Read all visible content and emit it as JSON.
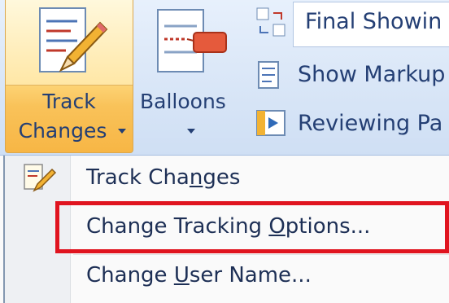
{
  "ribbon": {
    "track_changes": {
      "line1": "Track",
      "line2": "Changes",
      "icon": "track-changes-pencil-icon"
    },
    "balloons": {
      "label": "Balloons",
      "icon": "balloons-icon"
    },
    "final_showing": {
      "label": "Final Showin",
      "icon": "display-for-review-icon"
    },
    "show_markup": {
      "label": "Show Markup",
      "icon": "show-markup-icon"
    },
    "reviewing_pane": {
      "label": "Reviewing Pa",
      "icon": "reviewing-pane-icon"
    }
  },
  "menu": {
    "items": [
      {
        "pre": "Track Cha",
        "key": "n",
        "post": "ges",
        "icon": "track-changes-icon"
      },
      {
        "pre": "Change Tracking ",
        "key": "O",
        "post": "ptions..."
      },
      {
        "pre": "Change ",
        "key": "U",
        "post": "ser Name..."
      }
    ]
  },
  "colors": {
    "highlight": "#e0141f",
    "accent_text": "#243f74",
    "ribbon_bg": "#d9e6f7",
    "active_button": "#f9c259"
  }
}
